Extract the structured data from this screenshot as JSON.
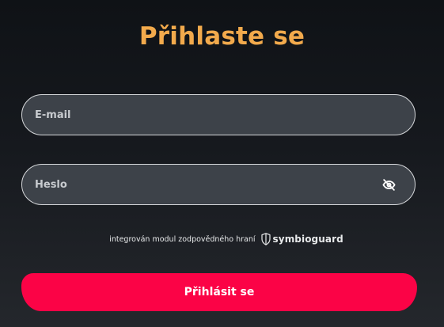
{
  "login": {
    "title": "Přihlaste se",
    "email_placeholder": "E-mail",
    "email_value": "",
    "password_placeholder": "Heslo",
    "password_value": "",
    "password_toggle_icon": "eye-off-icon",
    "responsible_gaming_text": "integrován modul zodpovědného hraní",
    "brand_name": "symbioguard",
    "brand_icon": "shield-icon",
    "submit_label": "Přihlásit se"
  },
  "colors": {
    "title": "#f2aa4c",
    "accent_button": "#fb0346",
    "field_background": "#3d4249",
    "field_border": "#d6d8db"
  }
}
